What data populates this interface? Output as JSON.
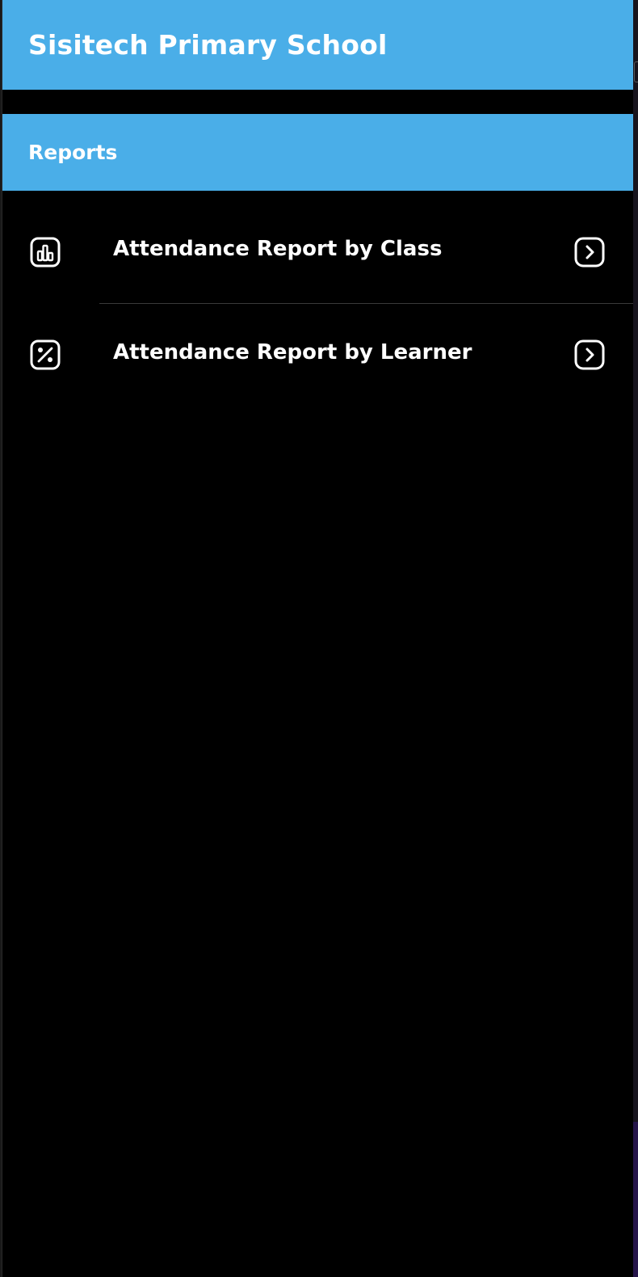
{
  "app": {
    "title": "Sisitech Primary School"
  },
  "section": {
    "title": "Reports"
  },
  "reports": [
    {
      "label": "Attendance Report by Class",
      "icon": "bar-chart-icon"
    },
    {
      "label": "Attendance Report by Learner",
      "icon": "percent-icon"
    }
  ],
  "colors": {
    "header_bg": "#4aaee8",
    "background": "#000000",
    "text": "#ffffff"
  }
}
